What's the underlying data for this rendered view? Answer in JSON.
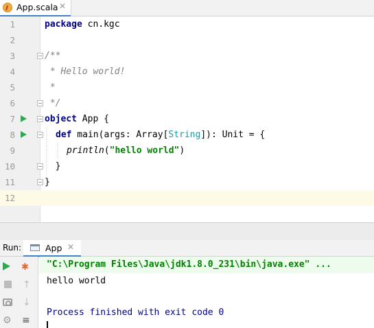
{
  "editor_tab": {
    "label": "App.scala",
    "close": "✕"
  },
  "editor": {
    "line_numbers": [
      "1",
      "2",
      "3",
      "4",
      "5",
      "6",
      "7",
      "8",
      "9",
      "10",
      "11",
      "12"
    ],
    "current_line": 12,
    "code": {
      "l1_kw": "package",
      "l1_rest": " cn.kgc",
      "l3": "/**",
      "l4": " * Hello world!",
      "l5": " *",
      "l6": " */",
      "l7_kw": "object",
      "l7_rest": " App {",
      "l8_kw": "def",
      "l8_a": " main(args: Array[",
      "l8_type": "String",
      "l8_b": "]): Unit = {",
      "l9_fn": "println",
      "l9_a": "(",
      "l9_str": "\"hello world\"",
      "l9_b": ")",
      "l10": "  }",
      "l11": "}"
    }
  },
  "run_panel": {
    "title": "Run:",
    "tab_label": "App",
    "tab_close": "✕",
    "command": "\"C:\\Program Files\\Java\\jdk1.8.0_231\\bin\\java.exe\" ...",
    "output": "hello world",
    "exit_message": "Process finished with exit code 0"
  },
  "colors": {
    "keyword": "#000080",
    "comment": "#808080",
    "string": "#008000",
    "type": "#20999d",
    "run_green": "#2fa84f",
    "current_line": "#fdfbe5"
  },
  "icons": [
    "scala-file-icon",
    "run-gutter-icon",
    "fold-icon",
    "rerun-icon",
    "stop-icon",
    "screenshot-icon",
    "settings-icon",
    "debug-icon",
    "up-arrow-icon",
    "down-arrow-icon",
    "soft-wrap-icon"
  ]
}
